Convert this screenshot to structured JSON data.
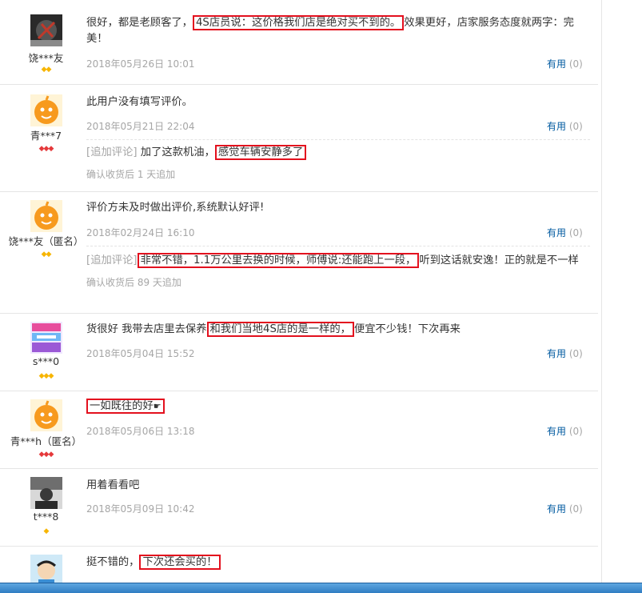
{
  "reviews": [
    {
      "user": "饶***友",
      "level_icons": "◆◆",
      "level_color": "#f7b500",
      "avatar": "dark-logo-avatar",
      "text_before": "很好，都是老顾客了，",
      "text_highlight": "4S店员说：这价格我们店是绝对买不到的。",
      "text_after": "效果更好，店家服务态度就两字：完美！",
      "date": "2018年05月26日 10:01",
      "useful_label": "有用",
      "useful_count": "(0)"
    },
    {
      "user": "青***7",
      "level_icons": "◆◆◆",
      "level_color": "#e5393b",
      "avatar": "orange-mascot-avatar",
      "text": "此用户没有填写评价。",
      "date": "2018年05月21日 22:04",
      "useful_label": "有用",
      "useful_count": "(0)",
      "append_tag": "[追加评论]",
      "append_before": " 加了这款机油，",
      "append_highlight": "感觉车辆安静多了",
      "append_meta": "确认收货后 1 天追加"
    },
    {
      "user": "饶***友（匿名）",
      "level_icons": "◆◆",
      "level_color": "#f7b500",
      "avatar": "orange-mascot-avatar",
      "text": "评价方未及时做出评价,系统默认好评!",
      "date": "2018年02月24日 16:10",
      "useful_label": "有用",
      "useful_count": "(0)",
      "append_tag": "[追加评论]",
      "append_highlight": "非常不错，1.1万公里去换的时候，师傅说:还能跑上一段，",
      "append_after": "听到这话就安逸！正的就是不一样",
      "append_meta": "确认收货后 89 天追加"
    },
    {
      "user": "s***0",
      "level_icons": "◆◆◆",
      "level_color": "#f7b500",
      "avatar": "colorful-shop-avatar",
      "text_before": "货很好 我带去店里去保养",
      "text_highlight": "和我们当地4S店的是一样的，",
      "text_after": "便宜不少钱！下次再来",
      "date": "2018年05月04日 15:52",
      "useful_label": "有用",
      "useful_count": "(0)"
    },
    {
      "user": "青***h（匿名）",
      "level_icons": "◆◆◆",
      "level_color": "#e5393b",
      "avatar": "orange-mascot-avatar",
      "text_highlight": "一如既往的好",
      "date": "2018年05月06日 13:18",
      "useful_label": "有用",
      "useful_count": "(0)"
    },
    {
      "user": "t***8",
      "level_icons": "◆",
      "level_color": "#f7b500",
      "avatar": "photo-avatar",
      "text": "用着看看吧",
      "date": "2018年05月09日 10:42",
      "useful_label": "有用",
      "useful_count": "(0)"
    },
    {
      "user": "",
      "level_icons": "",
      "level_color": "#f7b500",
      "avatar": "cartoon-avatar",
      "text_before": "挺不错的，",
      "text_highlight": "下次还会买的！",
      "text_after": "",
      "date": "",
      "useful_label": "",
      "useful_count": ""
    }
  ]
}
